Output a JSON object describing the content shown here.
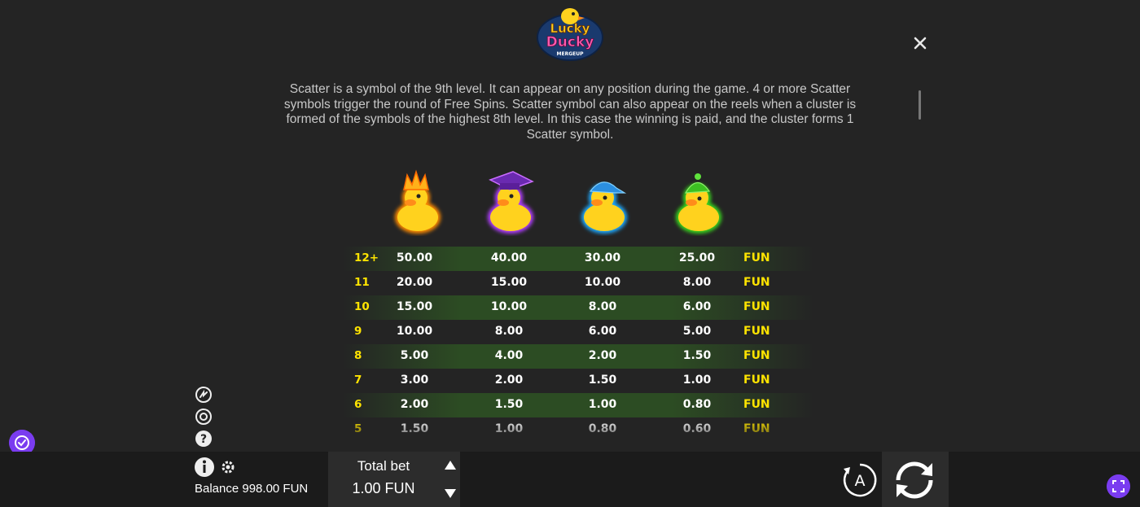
{
  "logo": {
    "line1": "Lucky",
    "line2": "Ducky",
    "line3": "MERGEUP"
  },
  "description": "Scatter is a symbol of the 9th level. It can appear on any position during the game. 4 or more Scatter symbols trigger the round of Free Spins. Scatter symbol can also appear on the reels when a cluster is formed of the symbols of the highest 8th level. In this case the winning is paid, and the cluster forms 1 Scatter symbol.",
  "symbols": [
    {
      "name": "crown-duck-icon",
      "color": "#ff8a00"
    },
    {
      "name": "graduate-duck-icon",
      "color": "#b13cff"
    },
    {
      "name": "cap-duck-icon",
      "color": "#1ea8ff"
    },
    {
      "name": "beanie-duck-icon",
      "color": "#37d61b"
    }
  ],
  "paytable": [
    {
      "count": "12+",
      "v1": "50.00",
      "v2": "40.00",
      "v3": "30.00",
      "v4": "25.00",
      "cur": "FUN"
    },
    {
      "count": "11",
      "v1": "20.00",
      "v2": "15.00",
      "v3": "10.00",
      "v4": "8.00",
      "cur": "FUN"
    },
    {
      "count": "10",
      "v1": "15.00",
      "v2": "10.00",
      "v3": "8.00",
      "v4": "6.00",
      "cur": "FUN"
    },
    {
      "count": "9",
      "v1": "10.00",
      "v2": "8.00",
      "v3": "6.00",
      "v4": "5.00",
      "cur": "FUN"
    },
    {
      "count": "8",
      "v1": "5.00",
      "v2": "4.00",
      "v3": "2.00",
      "v4": "1.50",
      "cur": "FUN"
    },
    {
      "count": "7",
      "v1": "3.00",
      "v2": "2.00",
      "v3": "1.50",
      "v4": "1.00",
      "cur": "FUN"
    },
    {
      "count": "6",
      "v1": "2.00",
      "v2": "1.50",
      "v3": "1.00",
      "v4": "0.80",
      "cur": "FUN"
    },
    {
      "count": "5",
      "v1": "1.50",
      "v2": "1.00",
      "v3": "0.80",
      "v4": "0.60",
      "cur": "FUN"
    }
  ],
  "footer": {
    "balance": "Balance 998.00 FUN",
    "bet_label": "Total bet",
    "bet_value": "1.00 FUN",
    "auto_label": "A"
  },
  "colors": {
    "accent_purple": "#7a3cf0",
    "highlight_yellow": "#ffe400",
    "row_green": "#2d5023"
  }
}
